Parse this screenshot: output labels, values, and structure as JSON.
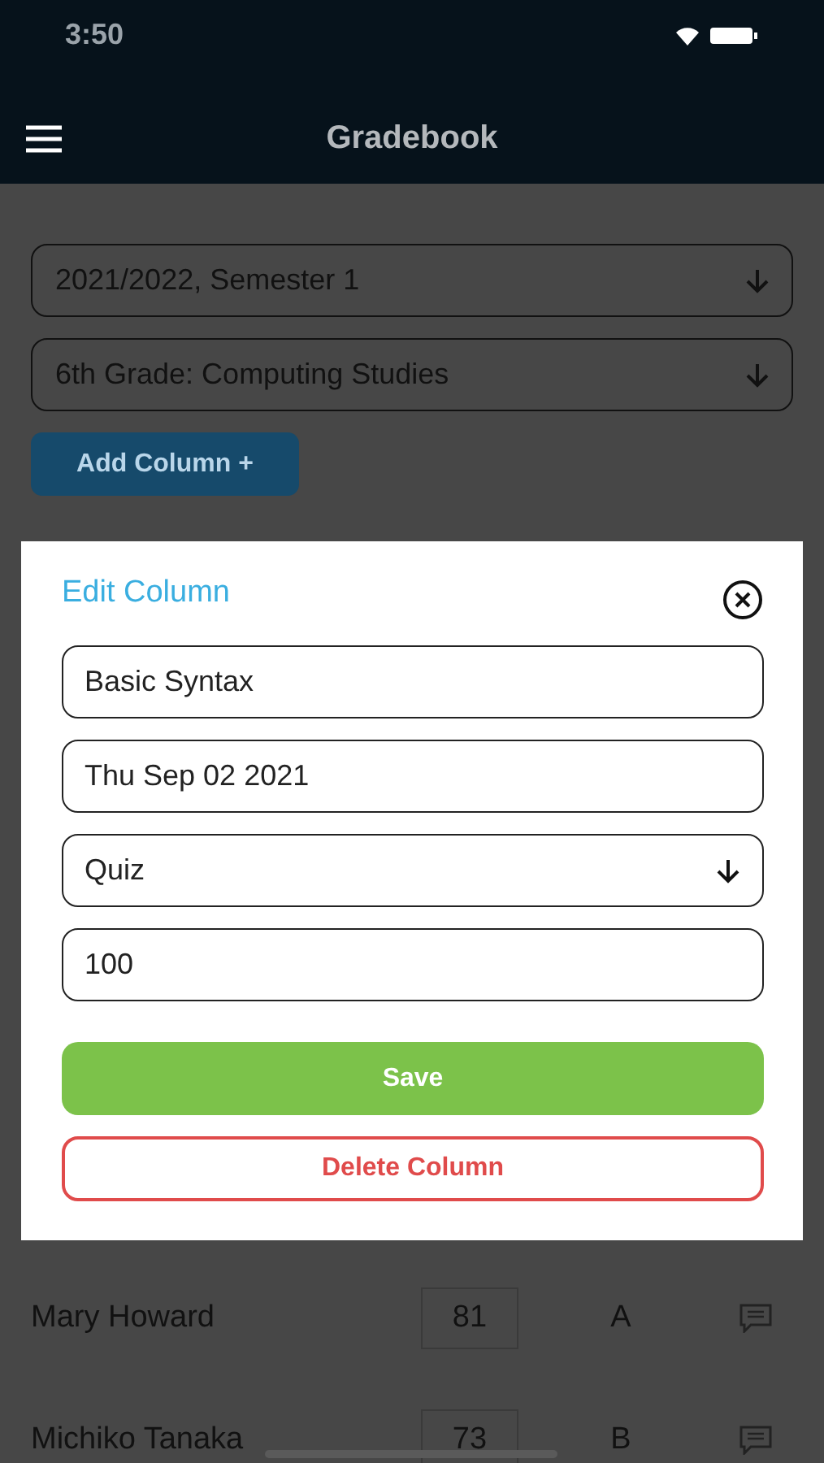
{
  "status_bar": {
    "time": "3:50"
  },
  "header": {
    "title": "Gradebook"
  },
  "filters": [
    {
      "value": "2021/2022, Semester 1"
    },
    {
      "value": "6th Grade: Computing Studies"
    }
  ],
  "add_button": "Add Column +",
  "table": {
    "rows": [
      {
        "name": "Mary Howard",
        "score": "81",
        "grade": "A"
      },
      {
        "name": "Michiko Tanaka",
        "score": "73",
        "grade": "B"
      }
    ]
  },
  "modal": {
    "title": "Edit Column",
    "fields": [
      {
        "kind": "text",
        "value": "Basic Syntax"
      },
      {
        "kind": "text",
        "value": "Thu Sep 02 2021"
      },
      {
        "kind": "select",
        "value": "Quiz"
      },
      {
        "kind": "text",
        "value": "100"
      }
    ],
    "buttons": [
      {
        "kind": "primary",
        "label": "Save"
      },
      {
        "kind": "danger",
        "label": "Delete Column"
      }
    ]
  }
}
